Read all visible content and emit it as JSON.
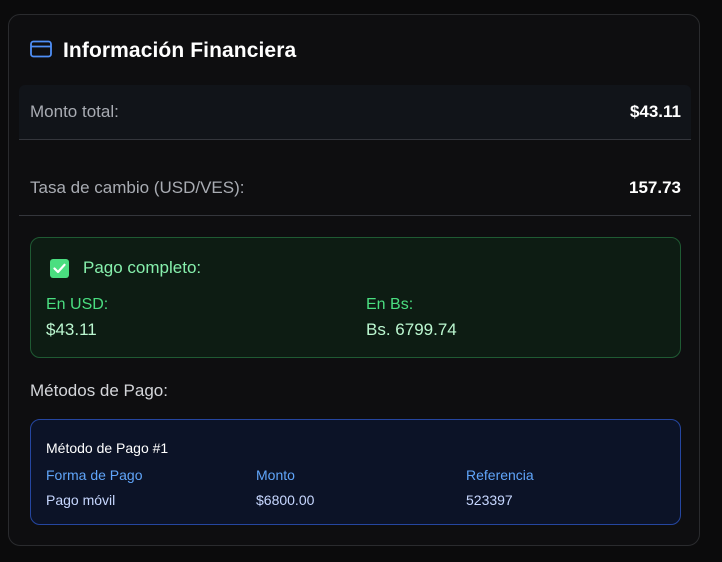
{
  "card": {
    "title": "Información Financiera",
    "icon": "credit-card-icon",
    "accent": "#4f8ff7"
  },
  "summary": {
    "total_label": "Monto total:",
    "total_value": "$43.11",
    "rate_label": "Tasa de cambio (USD/VES):",
    "rate_value": "157.73"
  },
  "payment_status": {
    "icon": "checkbox-checked-icon",
    "title": "Pago completo:",
    "usd_label": "En USD:",
    "usd_value": "$43.11",
    "bs_label": "En Bs:",
    "bs_value": "Bs. 6799.74",
    "color": "#4ade80"
  },
  "methods": {
    "title": "Métodos de Pago:",
    "items": [
      {
        "title": "Método de Pago #1",
        "form_label": "Forma de Pago",
        "form_value": "Pago móvil",
        "amount_label": "Monto",
        "amount_value": "$6800.00",
        "reference_label": "Referencia",
        "reference_value": "523397"
      }
    ]
  }
}
